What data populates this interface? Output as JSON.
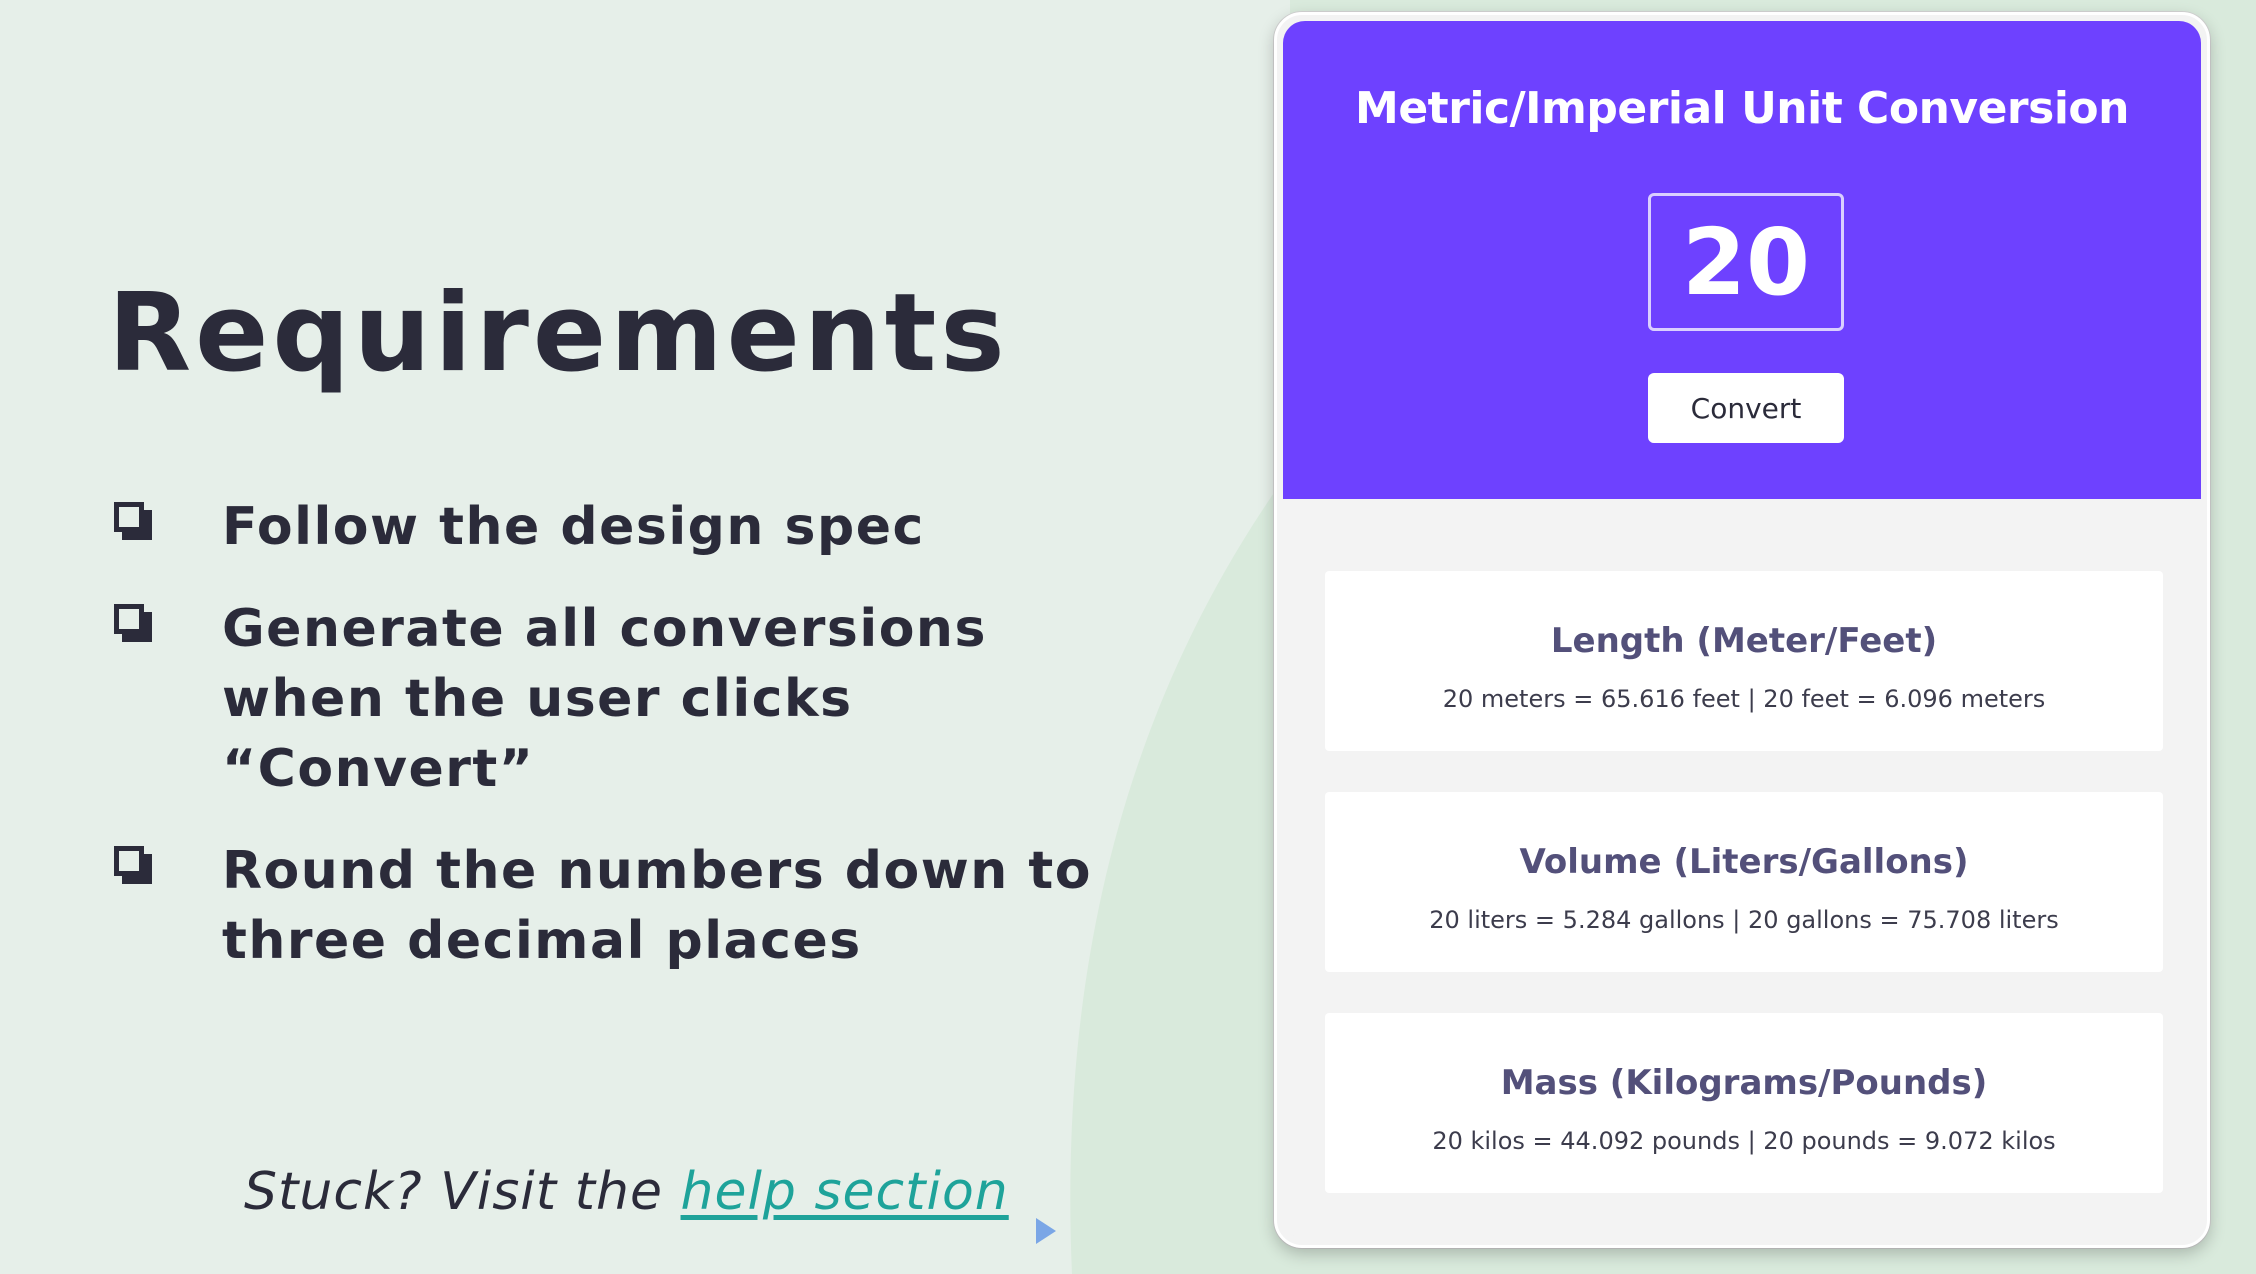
{
  "slide": {
    "title": "Requirements",
    "requirements": [
      "Follow the design spec",
      "Generate all conversions when the user clicks “Convert”",
      "Round the numbers down to three decimal places"
    ],
    "stuck_prefix": "Stuck? Visit the ",
    "help_link": "help section"
  },
  "app": {
    "title": "Metric/Imperial Unit Conversion",
    "input_value": "20",
    "convert_label": "Convert",
    "cards": [
      {
        "title": "Length (Meter/Feet)",
        "result": "20 meters = 65.616 feet | 20 feet = 6.096 meters"
      },
      {
        "title": "Volume (Liters/Gallons)",
        "result": "20 liters = 5.284 gallons | 20 gallons = 75.708 liters"
      },
      {
        "title": "Mass (Kilograms/Pounds)",
        "result": "20 kilos = 44.092 pounds | 20 pounds = 9.072 kilos"
      }
    ]
  },
  "colors": {
    "background": "#e6efe9",
    "accent": "#6e41ff",
    "link": "#1ea39a",
    "text": "#2b2b3a",
    "card_title": "#53507a"
  }
}
